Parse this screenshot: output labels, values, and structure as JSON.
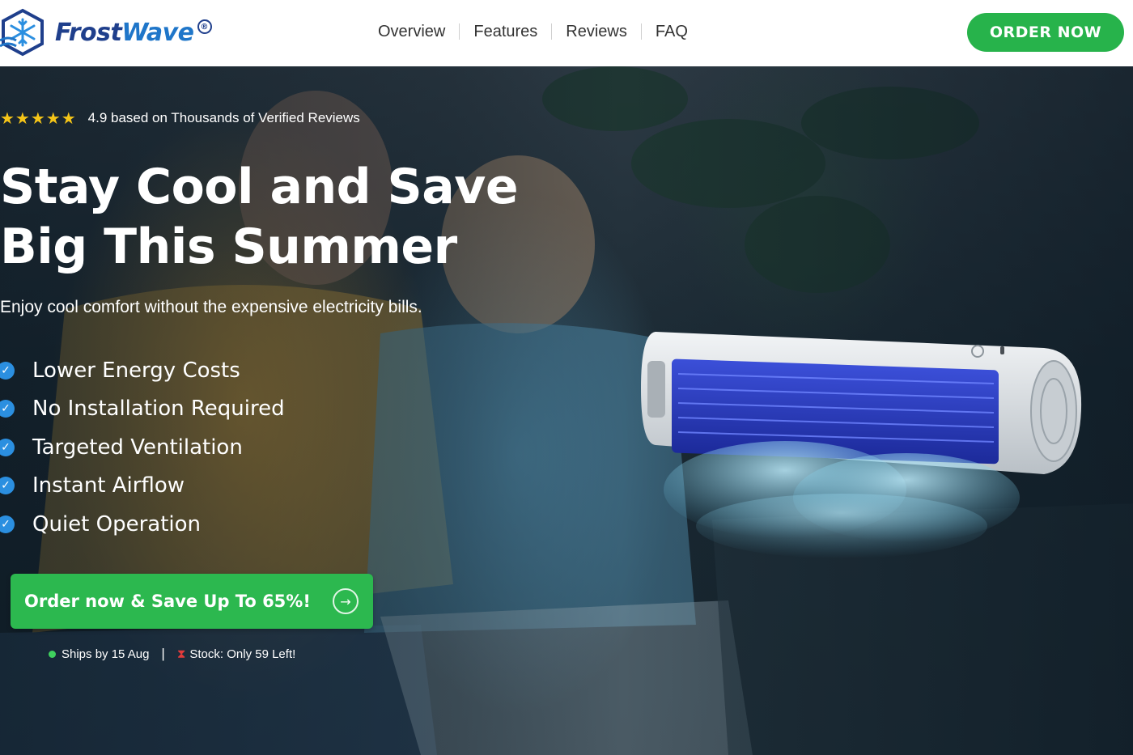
{
  "header": {
    "brand": {
      "name_part1": "Frost",
      "name_part2": "Wave",
      "badge": "®"
    },
    "nav": [
      {
        "label": "Overview"
      },
      {
        "label": "Features"
      },
      {
        "label": "Reviews"
      },
      {
        "label": "FAQ"
      }
    ],
    "order_button": "ORDER NOW"
  },
  "hero": {
    "rating": {
      "stars": "★★★★★",
      "text": "4.9 based on Thousands of Verified Reviews"
    },
    "headline_line1": "Stay Cool and Save",
    "headline_line2": "Big This Summer",
    "subline": "Enjoy cool comfort without the expensive electricity bills.",
    "benefits": [
      {
        "label": "Lower Energy Costs"
      },
      {
        "label": "No Installation Required"
      },
      {
        "label": "Targeted Ventilation"
      },
      {
        "label": "Instant Airflow"
      },
      {
        "label": "Quiet Operation"
      }
    ],
    "cta": {
      "label": "Order now & Save Up To 65%!",
      "arrow": "→"
    },
    "shipping": {
      "ships": "Ships by 15 Aug",
      "separator": "|",
      "stock": "Stock: Only 59 Left!"
    }
  },
  "icons": {
    "logo": "snowflake-hexagon-icon",
    "check": "checkmark-icon",
    "arrow": "arrow-right-icon",
    "dot": "green-dot-icon",
    "hourglass": "hourglass-icon"
  },
  "colors": {
    "brand_blue": "#1f3f8c",
    "accent_green": "#27b34b",
    "check_blue": "#2b8fe0",
    "star_yellow": "#f5c518",
    "stock_red": "#e23b3b"
  }
}
